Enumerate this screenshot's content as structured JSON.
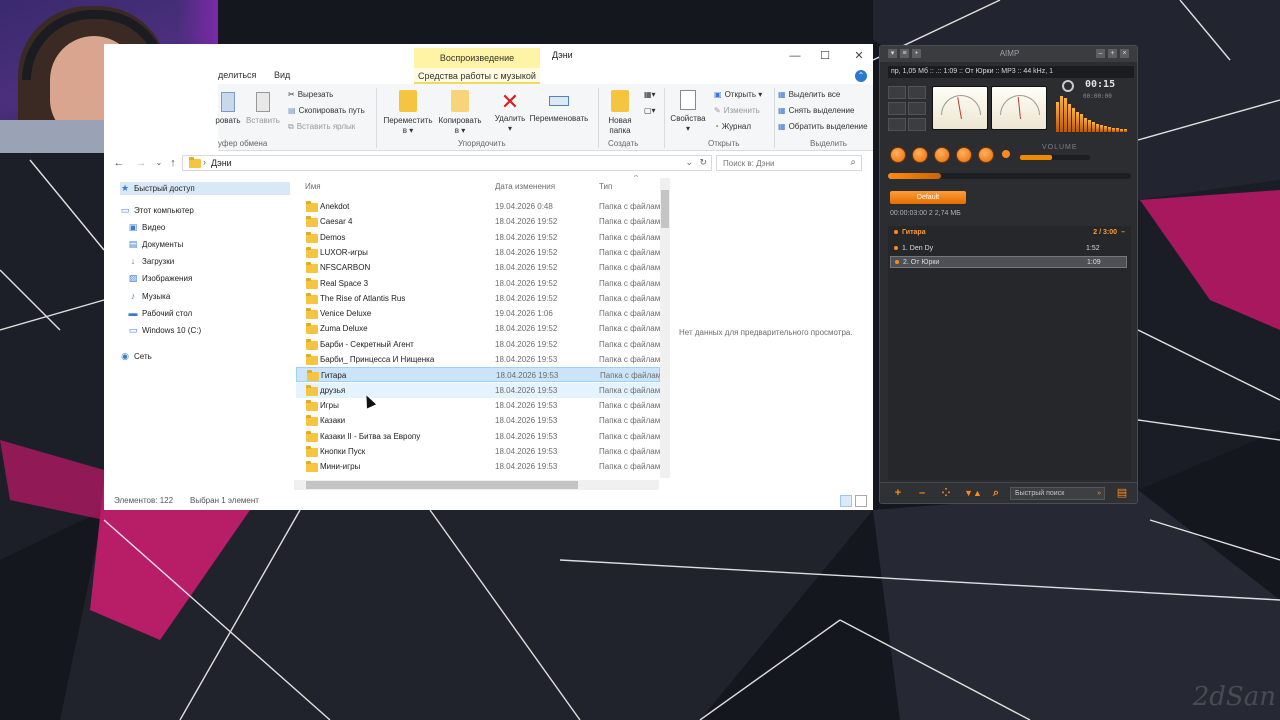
{
  "explorer": {
    "contextual_tab_header": "Воспроизведение",
    "window_title": "Дэни",
    "window_controls": {
      "minimize": "—",
      "maximize": "☐",
      "close": "✕"
    },
    "ribbon_tabs": {
      "share": "делиться",
      "view": "Вид",
      "music_tools": "Средства работы с музыкой"
    },
    "ribbon": {
      "clipboard": {
        "pin": "ровать",
        "paste": "Вставить",
        "cut": "Вырезать",
        "copy_path": "Скопировать путь",
        "paste_shortcut": "Вставить ярлык",
        "group": "уфер обмена"
      },
      "organize": {
        "move_to": "Переместить",
        "move_to_sub": "в ▾",
        "copy_to": "Копировать",
        "copy_to_sub": "в ▾",
        "delete": "Удалить",
        "delete_sub": "▾",
        "rename": "Переименовать",
        "group": "Упорядочить"
      },
      "new": {
        "new_folder": "Новая",
        "new_folder_sub": "папка",
        "group": "Создать"
      },
      "open": {
        "properties": "Свойства",
        "properties_sub": "▾",
        "open": "Открыть ▾",
        "edit": "Изменить",
        "history": "Журнал",
        "group": "Открыть"
      },
      "select": {
        "select_all": "Выделить все",
        "select_none": "Снять выделение",
        "invert": "Обратить выделение",
        "group": "Выделить"
      }
    },
    "address": {
      "path": "Дэни",
      "search_placeholder": "Поиск в: Дэни"
    },
    "nav_pane": [
      {
        "label": "Быстрый доступ",
        "icon": "star-icon"
      },
      {
        "label": "Этот компьютер",
        "icon": "computer-icon"
      },
      {
        "label": "Видео",
        "icon": "video-icon"
      },
      {
        "label": "Документы",
        "icon": "documents-icon"
      },
      {
        "label": "Загрузки",
        "icon": "download-icon"
      },
      {
        "label": "Изображения",
        "icon": "pictures-icon"
      },
      {
        "label": "Музыка",
        "icon": "music-icon"
      },
      {
        "label": "Рабочий стол",
        "icon": "desktop-icon"
      },
      {
        "label": "Windows 10 (C:)",
        "icon": "drive-icon"
      },
      {
        "label": "Сеть",
        "icon": "network-icon"
      }
    ],
    "columns": {
      "name": "Имя",
      "date": "Дата изменения",
      "type": "Тип"
    },
    "files": [
      {
        "name": "Anekdot",
        "date": "19.04.2026 0:48",
        "type": "Папка с файлами"
      },
      {
        "name": "Caesar 4",
        "date": "18.04.2026 19:52",
        "type": "Папка с файлами"
      },
      {
        "name": "Demos",
        "date": "18.04.2026 19:52",
        "type": "Папка с файлами"
      },
      {
        "name": "LUXOR-игры",
        "date": "18.04.2026 19:52",
        "type": "Папка с файлами"
      },
      {
        "name": "NFSCARBON",
        "date": "18.04.2026 19:52",
        "type": "Папка с файлами"
      },
      {
        "name": "Real Space 3",
        "date": "18.04.2026 19:52",
        "type": "Папка с файлами"
      },
      {
        "name": "The Rise of Atlantis Rus",
        "date": "18.04.2026 19:52",
        "type": "Папка с файлами"
      },
      {
        "name": "Venice Deluxe",
        "date": "19.04.2026 1:06",
        "type": "Папка с файлами"
      },
      {
        "name": "Zuma Deluxe",
        "date": "18.04.2026 19:52",
        "type": "Папка с файлами"
      },
      {
        "name": "Барби - Секретный Агент",
        "date": "18.04.2026 19:52",
        "type": "Папка с файлами"
      },
      {
        "name": "Барби_ Принцесса И Нищенка",
        "date": "18.04.2026 19:53",
        "type": "Папка с файлами"
      },
      {
        "name": "Гитара",
        "date": "18.04.2026 19:53",
        "type": "Папка с файлами"
      },
      {
        "name": "друзья",
        "date": "18.04.2026 19:53",
        "type": "Папка с файлами"
      },
      {
        "name": "Игры",
        "date": "18.04.2026 19:53",
        "type": "Папка с файлами"
      },
      {
        "name": "Казаки",
        "date": "18.04.2026 19:53",
        "type": "Папка с файлами"
      },
      {
        "name": "Казаки II - Битва за Европу",
        "date": "18.04.2026 19:53",
        "type": "Папка с файлами"
      },
      {
        "name": "Кнопки Пуск",
        "date": "18.04.2026 19:53",
        "type": "Папка с файлами"
      },
      {
        "name": "Мини-игры",
        "date": "18.04.2026 19:53",
        "type": "Папка с файлами"
      }
    ],
    "selected_index": 11,
    "hover_index": 12,
    "preview_text": "Нет данных для предварительного просмотра.",
    "status": {
      "count": "Элементов: 122",
      "selected": "Выбран 1 элемент"
    }
  },
  "aimp": {
    "title": "AIMP",
    "info_line": "пр, 1,05 Мб ::     .:: 1:09 :: От Юрки :: MP3 :: 44 kHz, 1",
    "time": "00:15",
    "time_remaining": "00:00:00",
    "volume_label": "VOLUME",
    "volume_level": 0.45,
    "seek_progress": 0.22,
    "playlist_tab": "Default",
    "playlist_info": "00:00:03:00    2       2,74 МБ",
    "group": {
      "name": "Гитара",
      "summary": "2 / 3:00"
    },
    "tracks": [
      {
        "title": "1. Den Dy",
        "duration": "1:52"
      },
      {
        "title": "2. От Юрки",
        "duration": "1:09"
      }
    ],
    "playing_index": 1,
    "quick_search": "Быстрый поиск",
    "accent": "#f08a00"
  },
  "desktop": {
    "signature": "2dSan",
    "accent_pink": "#e0207a"
  }
}
